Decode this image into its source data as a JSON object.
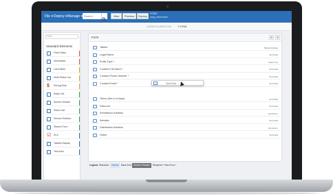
{
  "topbar": {
    "menus": [
      {
        "label": "File",
        "caret": "▾"
      },
      {
        "label": "Deploy",
        "caret": "▾"
      },
      {
        "label": "Manage",
        "caret": "▾"
      }
    ],
    "search_placeholder": "Search...",
    "search_icon": "magnifier",
    "buttons": [
      "View",
      "Preview",
      "Deploy"
    ],
    "form_name": "FORM",
    "form_subtitle": "pmg_newvendor"
  },
  "tabs": [
    "CONFIGURATION",
    "FORM"
  ],
  "active_tab": "FORM",
  "sidebar": {
    "filter_placeholder": "Filter",
    "heading": "Standard Elements",
    "items": [
      {
        "label": "Fixed Value",
        "icon": "form-icon",
        "accent": "#e05252"
      },
      {
        "label": "Information",
        "icon": "form-icon",
        "accent": "#e05252"
      },
      {
        "label": "List Builder",
        "icon": "form-icon",
        "accent": "#e0a030"
      },
      {
        "label": "Multi-Select List",
        "icon": "form-icon",
        "accent": "#e0a030"
      },
      {
        "label": "Pricing Rule",
        "icon": "dollar-icon",
        "accent": "#e0a030"
      },
      {
        "label": "Radio Set",
        "icon": "form-icon",
        "accent": "#3a9a5a"
      },
      {
        "label": "Section Header",
        "icon": "form-icon",
        "accent": "#3a9a5a"
      },
      {
        "label": "Select List",
        "icon": "form-icon",
        "accent": "#3a9a5a"
      },
      {
        "label": "Service Selector",
        "icon": "form-icon",
        "accent": "#3a9a5a"
      },
      {
        "label": "Shared Form",
        "icon": "form-icon",
        "accent": "#3a9a5a"
      },
      {
        "label": "SLA",
        "icon": "check-icon",
        "accent": "#2a6fb8"
      },
      {
        "label": "Tabbed Display",
        "icon": "form-icon",
        "accent": "#2a6fb8"
      },
      {
        "label": "Text Area",
        "icon": "form-icon",
        "accent": "#2a6fb8"
      }
    ]
  },
  "form": {
    "title": "Form",
    "fields": [
      {
        "label": "Tabber",
        "type": "Tabbed Display"
      },
      {
        "label": "Legal Name",
        "type": "Text Field"
      },
      {
        "label": "Entity Type *",
        "type": "Select List"
      },
      {
        "label": "Contact Full Name *",
        "type": "Text Field"
      },
      {
        "label": "Contact Phone Number *",
        "type": "Text Field"
      },
      {
        "label": "Contact Email *",
        "type": "Text Field"
      },
      {
        "label": "Terms (Net # of days)",
        "type": "Text Field"
      },
      {
        "label": "Discount",
        "type": "Text Field"
      },
      {
        "label": "Remittance Address",
        "type": "DynaForm"
      },
      {
        "label": "Website",
        "type": "Text Field"
      },
      {
        "label": "Distribution Address",
        "type": "DynaForm"
      },
      {
        "label": "Notes",
        "type": "Text Field"
      }
    ],
    "drag_ghost_label": "Text Field"
  },
  "legend": {
    "label": "Legend",
    "items": [
      "Standard",
      "Hidden",
      "Back End",
      "Section Header",
      "Required *",
      "Has Error !"
    ]
  },
  "colors": {
    "accent": "#2a6fb8",
    "bezel": "#1b1c1e"
  }
}
